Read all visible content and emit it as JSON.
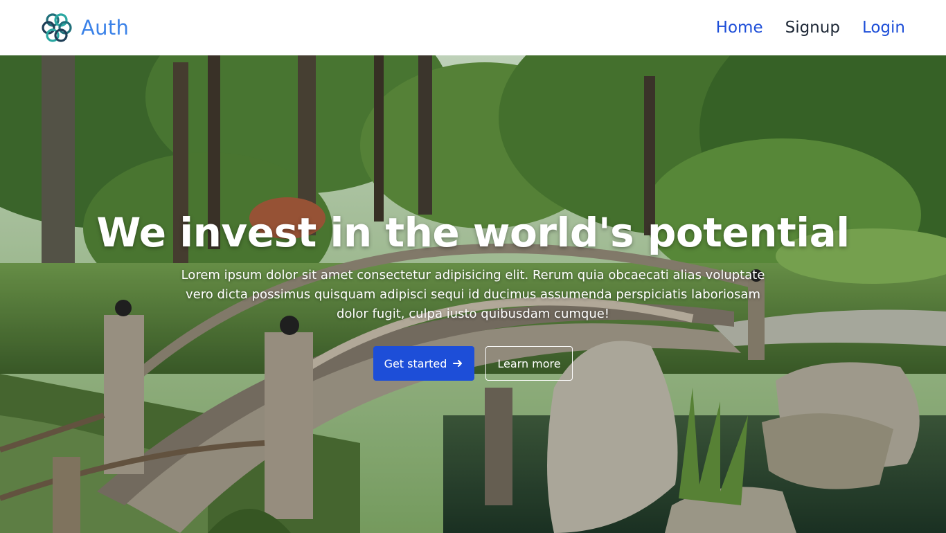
{
  "navbar": {
    "brand": "Auth",
    "links": [
      {
        "label": "Home",
        "active": true
      },
      {
        "label": "Signup",
        "active": false
      },
      {
        "label": "Login",
        "active": true
      }
    ]
  },
  "hero": {
    "title": "We invest in the world's potential",
    "text": "Lorem ipsum dolor sit amet consectetur adipisicing elit. Rerum quia obcaecati alias voluptate vero dicta possimus quisquam adipisci sequi id ducimus assumenda perspiciatis laboriosam dolor fugit, culpa iusto quibusdam cumque!",
    "primary_button": "Get started",
    "secondary_button": "Learn more",
    "background": "garden-bridge-photo"
  },
  "icons": {
    "logo": "knot-logo-icon",
    "arrow": "arrow-right-icon"
  },
  "colors": {
    "brand": "#3b82e8",
    "link": "#1d4ed8",
    "primary_button": "#1d4ed8"
  }
}
